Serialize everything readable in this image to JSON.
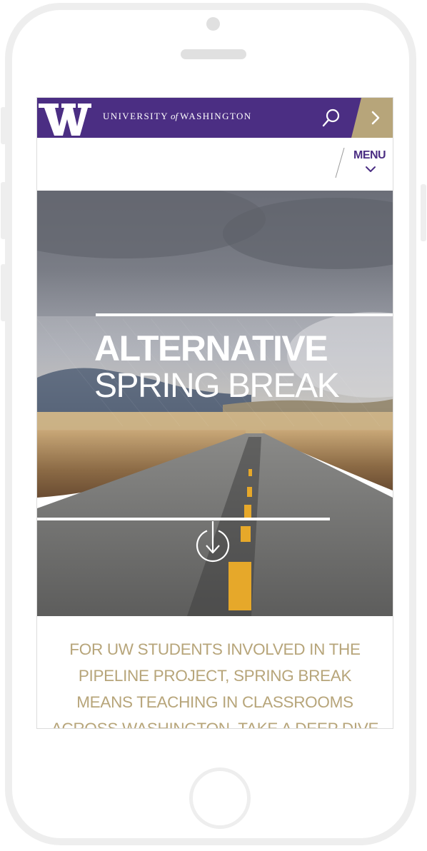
{
  "header": {
    "wordmark_pre": "UNIVERSITY",
    "wordmark_of": "of",
    "wordmark_post": "WASHINGTON",
    "search_icon": "search-icon",
    "next_icon": "chevron-right-icon",
    "brand_purple": "#4b2e83",
    "brand_gold": "#b7a57a"
  },
  "menu": {
    "label": "MENU",
    "chevron_icon": "chevron-down-icon"
  },
  "hero": {
    "title_line1": "ALTERNATIVE",
    "title_line2": "SPRING BREAK",
    "scroll_icon": "arrow-down-circle-icon"
  },
  "intro": {
    "lines": [
      "FOR UW STUDENTS INVOLVED IN THE",
      "PIPELINE PROJECT, SPRING BREAK",
      "MEANS TEACHING IN CLASSROOMS",
      "ACROSS WASHINGTON. TAKE A DEEP DIVE"
    ]
  }
}
